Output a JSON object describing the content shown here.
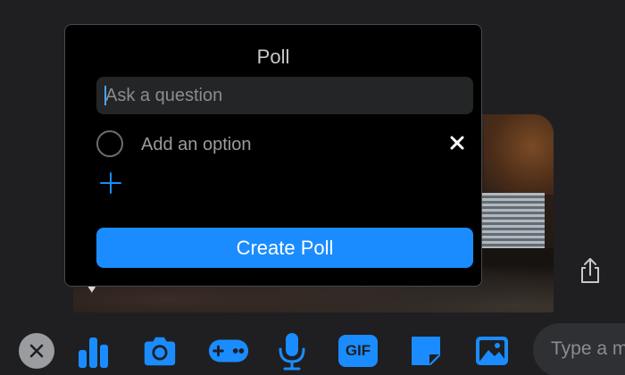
{
  "poll": {
    "title": "Poll",
    "question_placeholder": "Ask a question",
    "question_value": "",
    "options": [
      {
        "placeholder": "Add an option",
        "value": ""
      }
    ],
    "create_label": "Create Poll"
  },
  "composer": {
    "message_placeholder": "Type a m",
    "icons": [
      "close-icon",
      "poll-icon",
      "camera-icon",
      "game-controller-icon",
      "microphone-icon",
      "gif-icon",
      "sticker-icon",
      "image-icon"
    ],
    "gif_label": "GIF"
  },
  "colors": {
    "accent": "#1a8cff",
    "panel_bg": "#000000",
    "toolbar_bg": "#1f1f21",
    "icon_blue": "#1a8cff"
  }
}
